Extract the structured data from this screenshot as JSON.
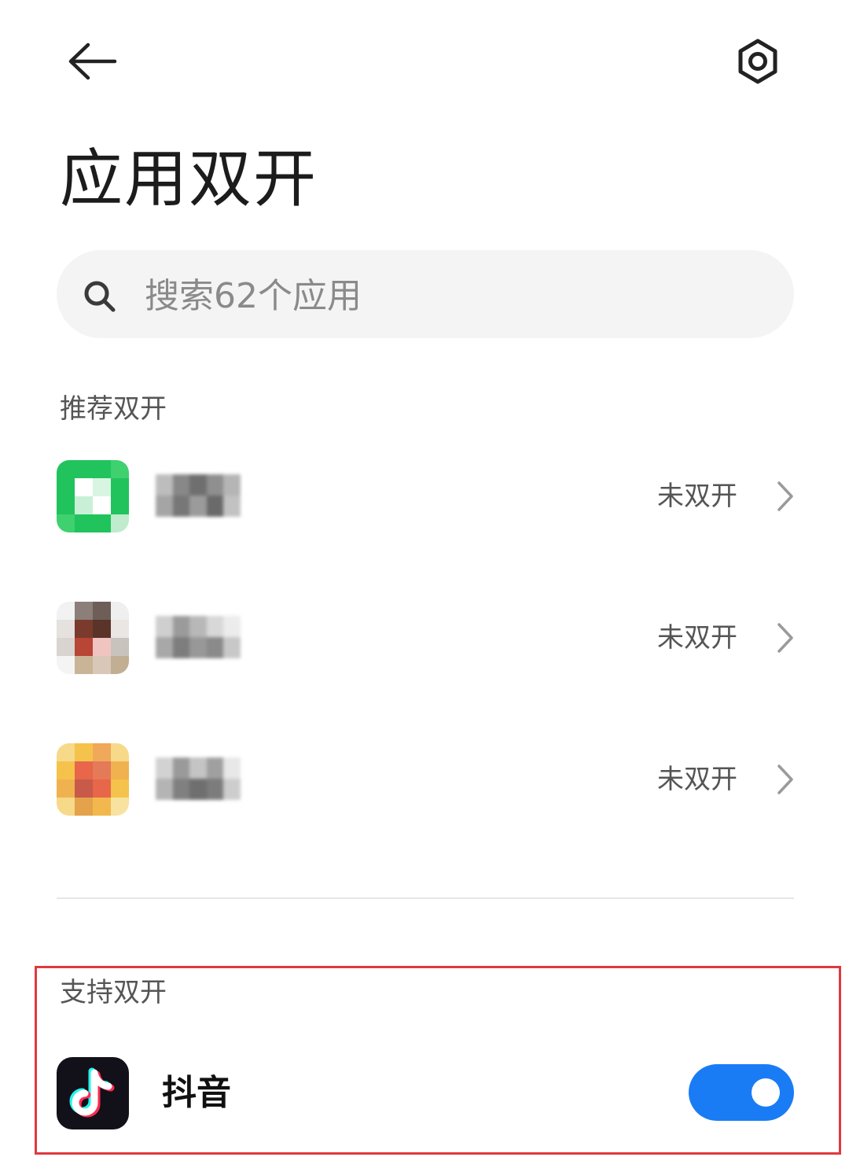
{
  "header": {
    "back_icon": "arrow-left-icon",
    "settings_icon": "hexagon-gear-icon",
    "title": "应用双开"
  },
  "search": {
    "placeholder": "搜索62个应用",
    "icon": "search-icon"
  },
  "recommended": {
    "label": "推荐双开",
    "items": [
      {
        "status": "未双开",
        "icon_colors": [
          "#21c35c",
          "#bfeccd",
          "#ffffff"
        ]
      },
      {
        "status": "未双开",
        "icon_colors": [
          "#7a3b2c",
          "#b84535",
          "#d9c7b8"
        ]
      },
      {
        "status": "未双开",
        "icon_colors": [
          "#f5c34b",
          "#e8664a",
          "#f7d98a"
        ]
      }
    ]
  },
  "supported": {
    "label": "支持双开",
    "items": [
      {
        "name": "抖音",
        "enabled": true,
        "icon": "tiktok-icon"
      }
    ]
  },
  "colors": {
    "accent": "#1a7cf5",
    "highlight_border": "#e0393e",
    "search_bg": "#f4f4f4"
  }
}
